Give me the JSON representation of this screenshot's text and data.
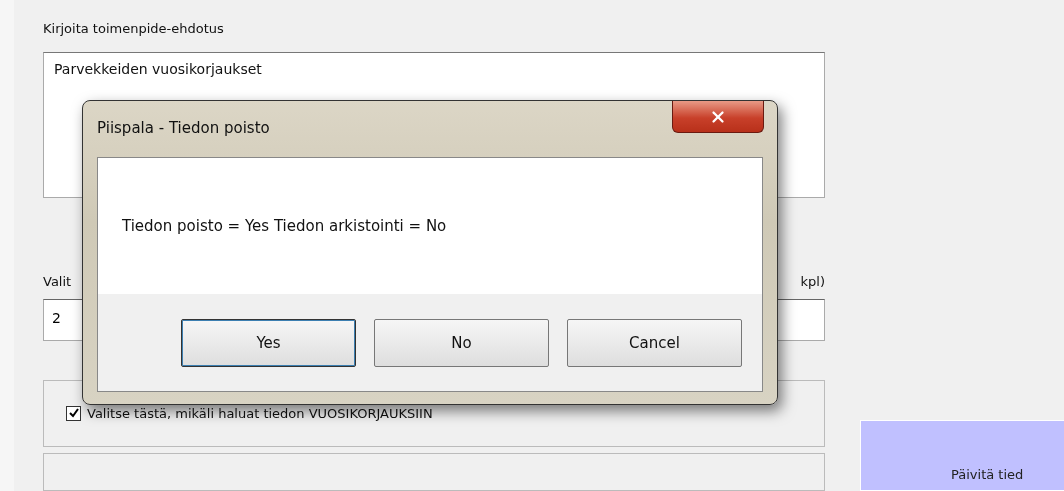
{
  "form": {
    "proposal_label": "Kirjoita toimenpide-ehdotus",
    "proposal_value": "Parvekkeiden vuosikorjaukset",
    "select_label": "Valit",
    "count_label": "kpl)",
    "year_value": "2",
    "annual_repairs": {
      "label": "Valitse tästä, mikäli haluat tiedon VUOSIKORJAUKSIIN",
      "checked": true
    }
  },
  "update_button": {
    "label": "Päivitä tied"
  },
  "dialog": {
    "title": "Piispala - Tiedon poisto",
    "message": "Tiedon poisto = Yes Tiedon arkistointi = No",
    "buttons": [
      {
        "label": "Yes",
        "selected": true
      },
      {
        "label": "No",
        "selected": false
      },
      {
        "label": "Cancel",
        "selected": false
      }
    ]
  }
}
